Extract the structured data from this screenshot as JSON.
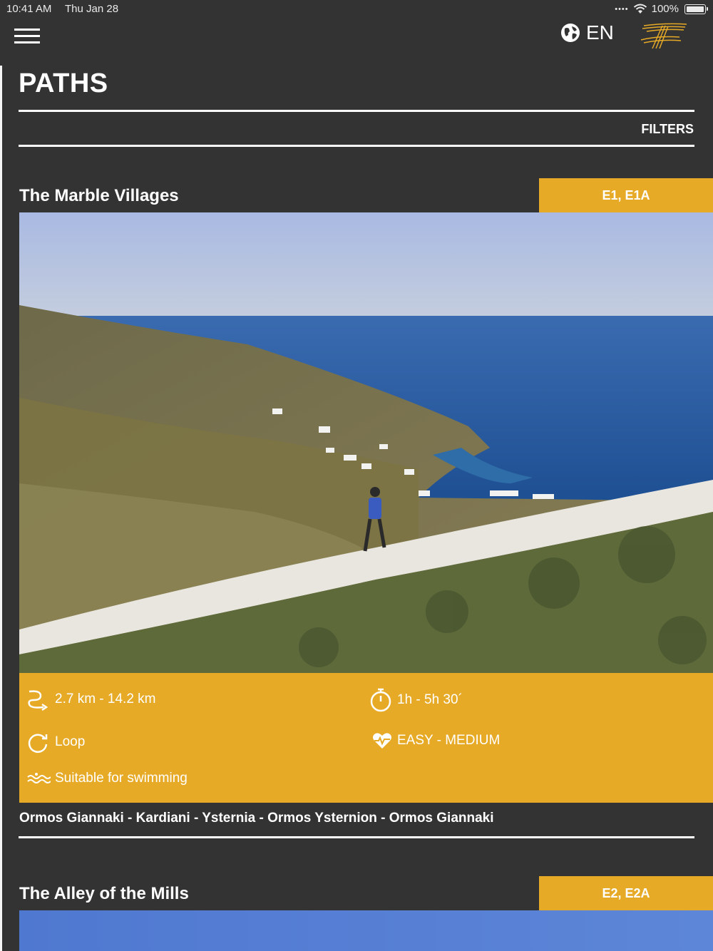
{
  "status": {
    "time": "10:41 AM",
    "date": "Thu Jan 28",
    "battery": "100%"
  },
  "header": {
    "language": "EN",
    "menu_icon": "hamburger-menu-icon",
    "globe_icon": "globe-icon",
    "logo_icon": "brand-logo-icon"
  },
  "page": {
    "title": "PATHS",
    "filters_label": "FILTERS"
  },
  "colors": {
    "background": "#333333",
    "accent": "#e6aa26",
    "text": "#ffffff"
  },
  "paths": [
    {
      "title": "The Marble Villages",
      "codes": "E1, E1A",
      "distance": "2.7 km - 14.2 km",
      "duration": "1h - 5h 30´",
      "route_type": "Loop",
      "difficulty": "EASY - MEDIUM",
      "feature": "Suitable for swimming",
      "route": "Ormos Giannaki - Kardiani - Ysternia - Ormos Ysternion - Ormos Giannaki"
    },
    {
      "title": "The Alley of the Mills",
      "codes": "E2, E2A"
    }
  ]
}
